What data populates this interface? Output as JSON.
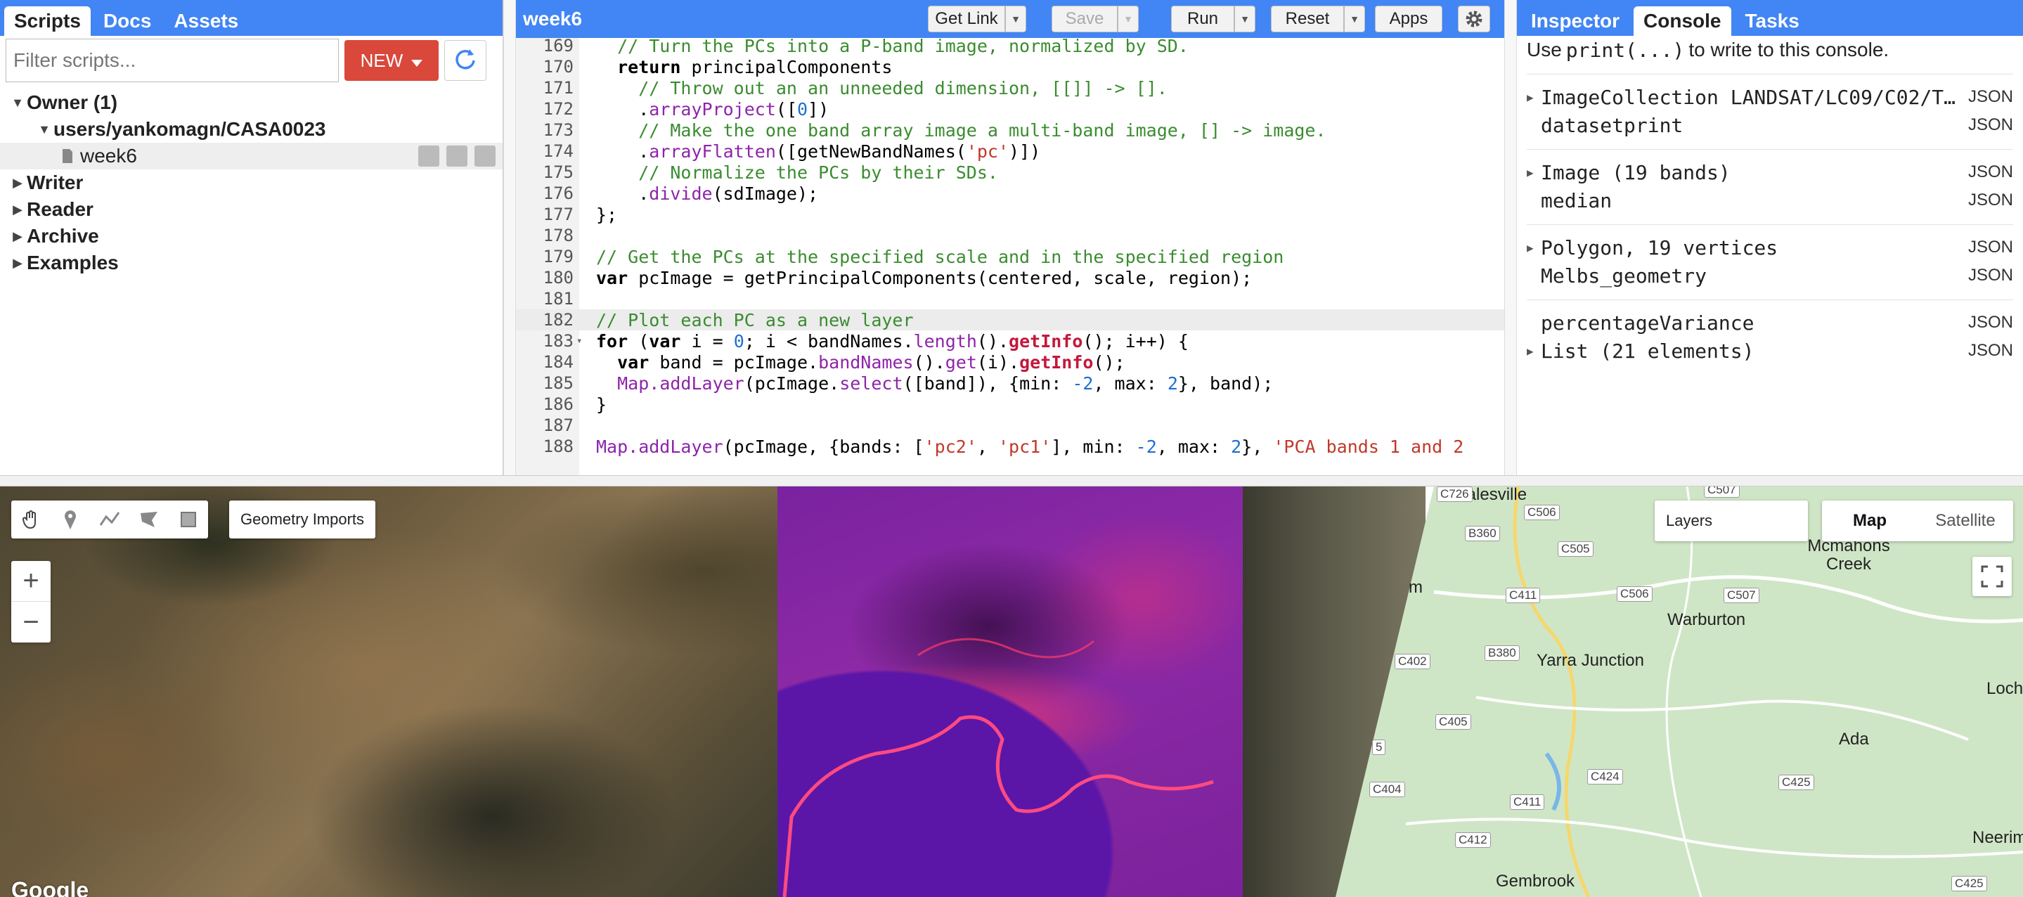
{
  "left_panel": {
    "tabs": [
      {
        "label": "Scripts",
        "active": true
      },
      {
        "label": "Docs",
        "active": false
      },
      {
        "label": "Assets",
        "active": false
      }
    ],
    "filter_placeholder": "Filter scripts...",
    "new_button": "NEW",
    "tree": {
      "owner": "Owner (1)",
      "repo": "users/yankomagn/CASA0023",
      "file": "week6",
      "writer": "Writer",
      "reader": "Reader",
      "archive": "Archive",
      "examples": "Examples"
    }
  },
  "editor": {
    "title": "week6",
    "buttons": {
      "get_link": "Get Link",
      "save": "Save",
      "run": "Run",
      "reset": "Reset",
      "apps": "Apps"
    }
  },
  "code_lines": [
    {
      "n": "169",
      "segs": [
        {
          "t": "  // Turn the PCs into a P-band image, normalized by SD.",
          "c": "c-com"
        }
      ]
    },
    {
      "n": "170",
      "segs": [
        {
          "t": "  return",
          "c": "c-kw"
        },
        {
          "t": " principalComponents",
          "c": ""
        }
      ]
    },
    {
      "n": "171",
      "segs": [
        {
          "t": "    // Throw out an an unneeded dimension, [[]] -> [].",
          "c": "c-com"
        }
      ]
    },
    {
      "n": "172",
      "segs": [
        {
          "t": "    .",
          "c": ""
        },
        {
          "t": "arrayProject",
          "c": "c-fn"
        },
        {
          "t": "([",
          "c": ""
        },
        {
          "t": "0",
          "c": "c-num"
        },
        {
          "t": "])",
          "c": ""
        }
      ]
    },
    {
      "n": "173",
      "segs": [
        {
          "t": "    // Make the one band array image a multi-band image, [] -> image.",
          "c": "c-com"
        }
      ]
    },
    {
      "n": "174",
      "segs": [
        {
          "t": "    .",
          "c": ""
        },
        {
          "t": "arrayFlatten",
          "c": "c-fn"
        },
        {
          "t": "([getNewBandNames(",
          "c": ""
        },
        {
          "t": "'pc'",
          "c": "c-str"
        },
        {
          "t": ")])",
          "c": ""
        }
      ]
    },
    {
      "n": "175",
      "segs": [
        {
          "t": "    // Normalize the PCs by their SDs.",
          "c": "c-com"
        }
      ]
    },
    {
      "n": "176",
      "segs": [
        {
          "t": "    .",
          "c": ""
        },
        {
          "t": "divide",
          "c": "c-fn"
        },
        {
          "t": "(sdImage);",
          "c": ""
        }
      ]
    },
    {
      "n": "177",
      "segs": [
        {
          "t": "};",
          "c": ""
        }
      ]
    },
    {
      "n": "178",
      "segs": [
        {
          "t": "",
          "c": ""
        }
      ]
    },
    {
      "n": "179",
      "segs": [
        {
          "t": "// Get the PCs at the specified scale and in the specified region",
          "c": "c-com"
        }
      ]
    },
    {
      "n": "180",
      "segs": [
        {
          "t": "var",
          "c": "c-kw"
        },
        {
          "t": " pcImage = getPrincipalComponents(centered, scale, region);",
          "c": ""
        }
      ]
    },
    {
      "n": "181",
      "segs": [
        {
          "t": "",
          "c": ""
        }
      ]
    },
    {
      "n": "182",
      "segs": [
        {
          "t": "// Plot each PC as a new layer",
          "c": "c-com"
        }
      ]
    },
    {
      "n": "183",
      "segs": [
        {
          "t": "for",
          "c": "c-kw"
        },
        {
          "t": " (",
          "c": ""
        },
        {
          "t": "var",
          "c": "c-kw"
        },
        {
          "t": " i = ",
          "c": ""
        },
        {
          "t": "0",
          "c": "c-num"
        },
        {
          "t": "; i < bandNames.",
          "c": ""
        },
        {
          "t": "length",
          "c": "c-fn"
        },
        {
          "t": "().",
          "c": ""
        },
        {
          "t": "getInfo",
          "c": "c-red"
        },
        {
          "t": "(); i++) {",
          "c": ""
        }
      ]
    },
    {
      "n": "184",
      "segs": [
        {
          "t": "  var",
          "c": "c-kw"
        },
        {
          "t": " band = pcImage.",
          "c": ""
        },
        {
          "t": "bandNames",
          "c": "c-fn"
        },
        {
          "t": "().",
          "c": ""
        },
        {
          "t": "get",
          "c": "c-fn"
        },
        {
          "t": "(i).",
          "c": ""
        },
        {
          "t": "getInfo",
          "c": "c-red"
        },
        {
          "t": "();",
          "c": ""
        }
      ]
    },
    {
      "n": "185",
      "segs": [
        {
          "t": "  ",
          "c": ""
        },
        {
          "t": "Map.addLayer",
          "c": "c-fn"
        },
        {
          "t": "(pcImage.",
          "c": ""
        },
        {
          "t": "select",
          "c": "c-fn"
        },
        {
          "t": "([band]), {min: ",
          "c": ""
        },
        {
          "t": "-2",
          "c": "c-num"
        },
        {
          "t": ", max: ",
          "c": ""
        },
        {
          "t": "2",
          "c": "c-num"
        },
        {
          "t": "}, band);",
          "c": ""
        }
      ]
    },
    {
      "n": "186",
      "segs": [
        {
          "t": "}",
          "c": ""
        }
      ]
    },
    {
      "n": "187",
      "segs": [
        {
          "t": "",
          "c": ""
        }
      ]
    },
    {
      "n": "188",
      "segs": [
        {
          "t": "Map.addLayer",
          "c": "c-fn"
        },
        {
          "t": "(pcImage, {bands: [",
          "c": ""
        },
        {
          "t": "'pc2'",
          "c": "c-str"
        },
        {
          "t": ", ",
          "c": ""
        },
        {
          "t": "'pc1'",
          "c": "c-str"
        },
        {
          "t": "], min: ",
          "c": ""
        },
        {
          "t": "-2",
          "c": "c-num"
        },
        {
          "t": ", max: ",
          "c": ""
        },
        {
          "t": "2",
          "c": "c-num"
        },
        {
          "t": "}, ",
          "c": ""
        },
        {
          "t": "'PCA bands 1 and 2",
          "c": "c-str"
        }
      ]
    }
  ],
  "right_panel": {
    "tabs": [
      {
        "label": "Inspector",
        "active": false
      },
      {
        "label": "Console",
        "active": true
      },
      {
        "label": "Tasks",
        "active": false
      }
    ],
    "hint_prefix": "Use ",
    "hint_code": "print(...)",
    "hint_suffix": " to write to this console.",
    "json_label": "JSON",
    "entries": [
      {
        "object": "ImageCollection LANDSAT/LC09/C02/T…",
        "name": "datasetprint"
      },
      {
        "object": "Image (19 bands)",
        "name": "median"
      },
      {
        "object": "Polygon, 19 vertices",
        "name": "Melbs_geometry"
      },
      {
        "object": "percentageVariance",
        "name": "List (21 elements)"
      }
    ]
  },
  "map": {
    "geometry_imports": "Geometry Imports",
    "zoom_in": "+",
    "zoom_out": "−",
    "layers": "Layers",
    "map_type": {
      "map": "Map",
      "satellite": "Satellite"
    },
    "attribution": "Google",
    "places": {
      "healesville": "Healesville",
      "mcmahons_creek": "Mcmahons Creek",
      "warburton": "Warburton",
      "yarra_junction": "Yarra Junction",
      "ada": "Ada",
      "neerim": "Neerim",
      "gembrook": "Gembrook",
      "loch": "Loch",
      "m": "m"
    },
    "roads": {
      "c726": "C726",
      "c506a": "C506",
      "b360": "B360",
      "c505": "C505",
      "c506b": "C506",
      "c507a": "C507",
      "c507b": "C507",
      "c411a": "C411",
      "c402": "C402",
      "b380": "B380",
      "c405": "C405",
      "c404": "C404",
      "c424": "C424",
      "c425a": "C425",
      "c411b": "C411",
      "c412": "C412",
      "c425b": "C425",
      "r5": "5"
    }
  }
}
